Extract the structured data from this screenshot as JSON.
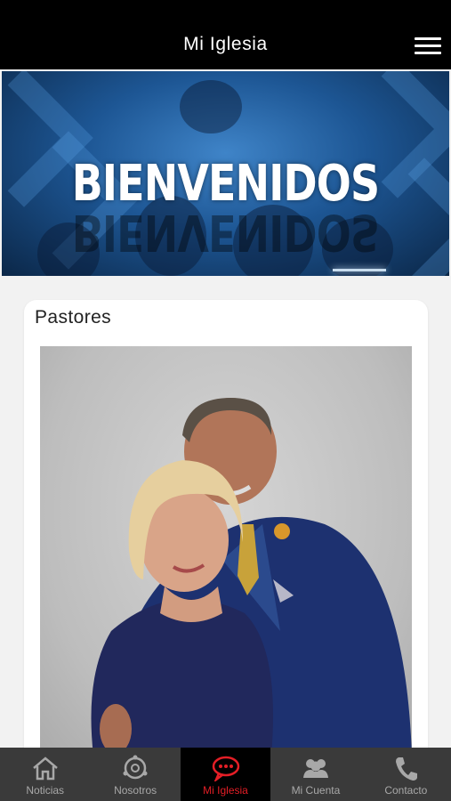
{
  "header": {
    "title": "Mi Iglesia"
  },
  "banner": {
    "text": "BIENVENIDOS"
  },
  "section": {
    "title": "Pastores"
  },
  "tabs": [
    {
      "label": "Noticias",
      "icon": "home-icon",
      "active": false
    },
    {
      "label": "Nosotros",
      "icon": "info-circle-icon",
      "active": false
    },
    {
      "label": "Mi Iglesia",
      "icon": "chat-bubble-icon",
      "active": true
    },
    {
      "label": "Mi Cuenta",
      "icon": "people-icon",
      "active": false
    },
    {
      "label": "Contacto",
      "icon": "phone-icon",
      "active": false
    }
  ],
  "colors": {
    "header_bg": "#000000",
    "tab_bg": "#3a3a3a",
    "active_tab": "#e41e26",
    "banner_blue": "#1d5694"
  }
}
